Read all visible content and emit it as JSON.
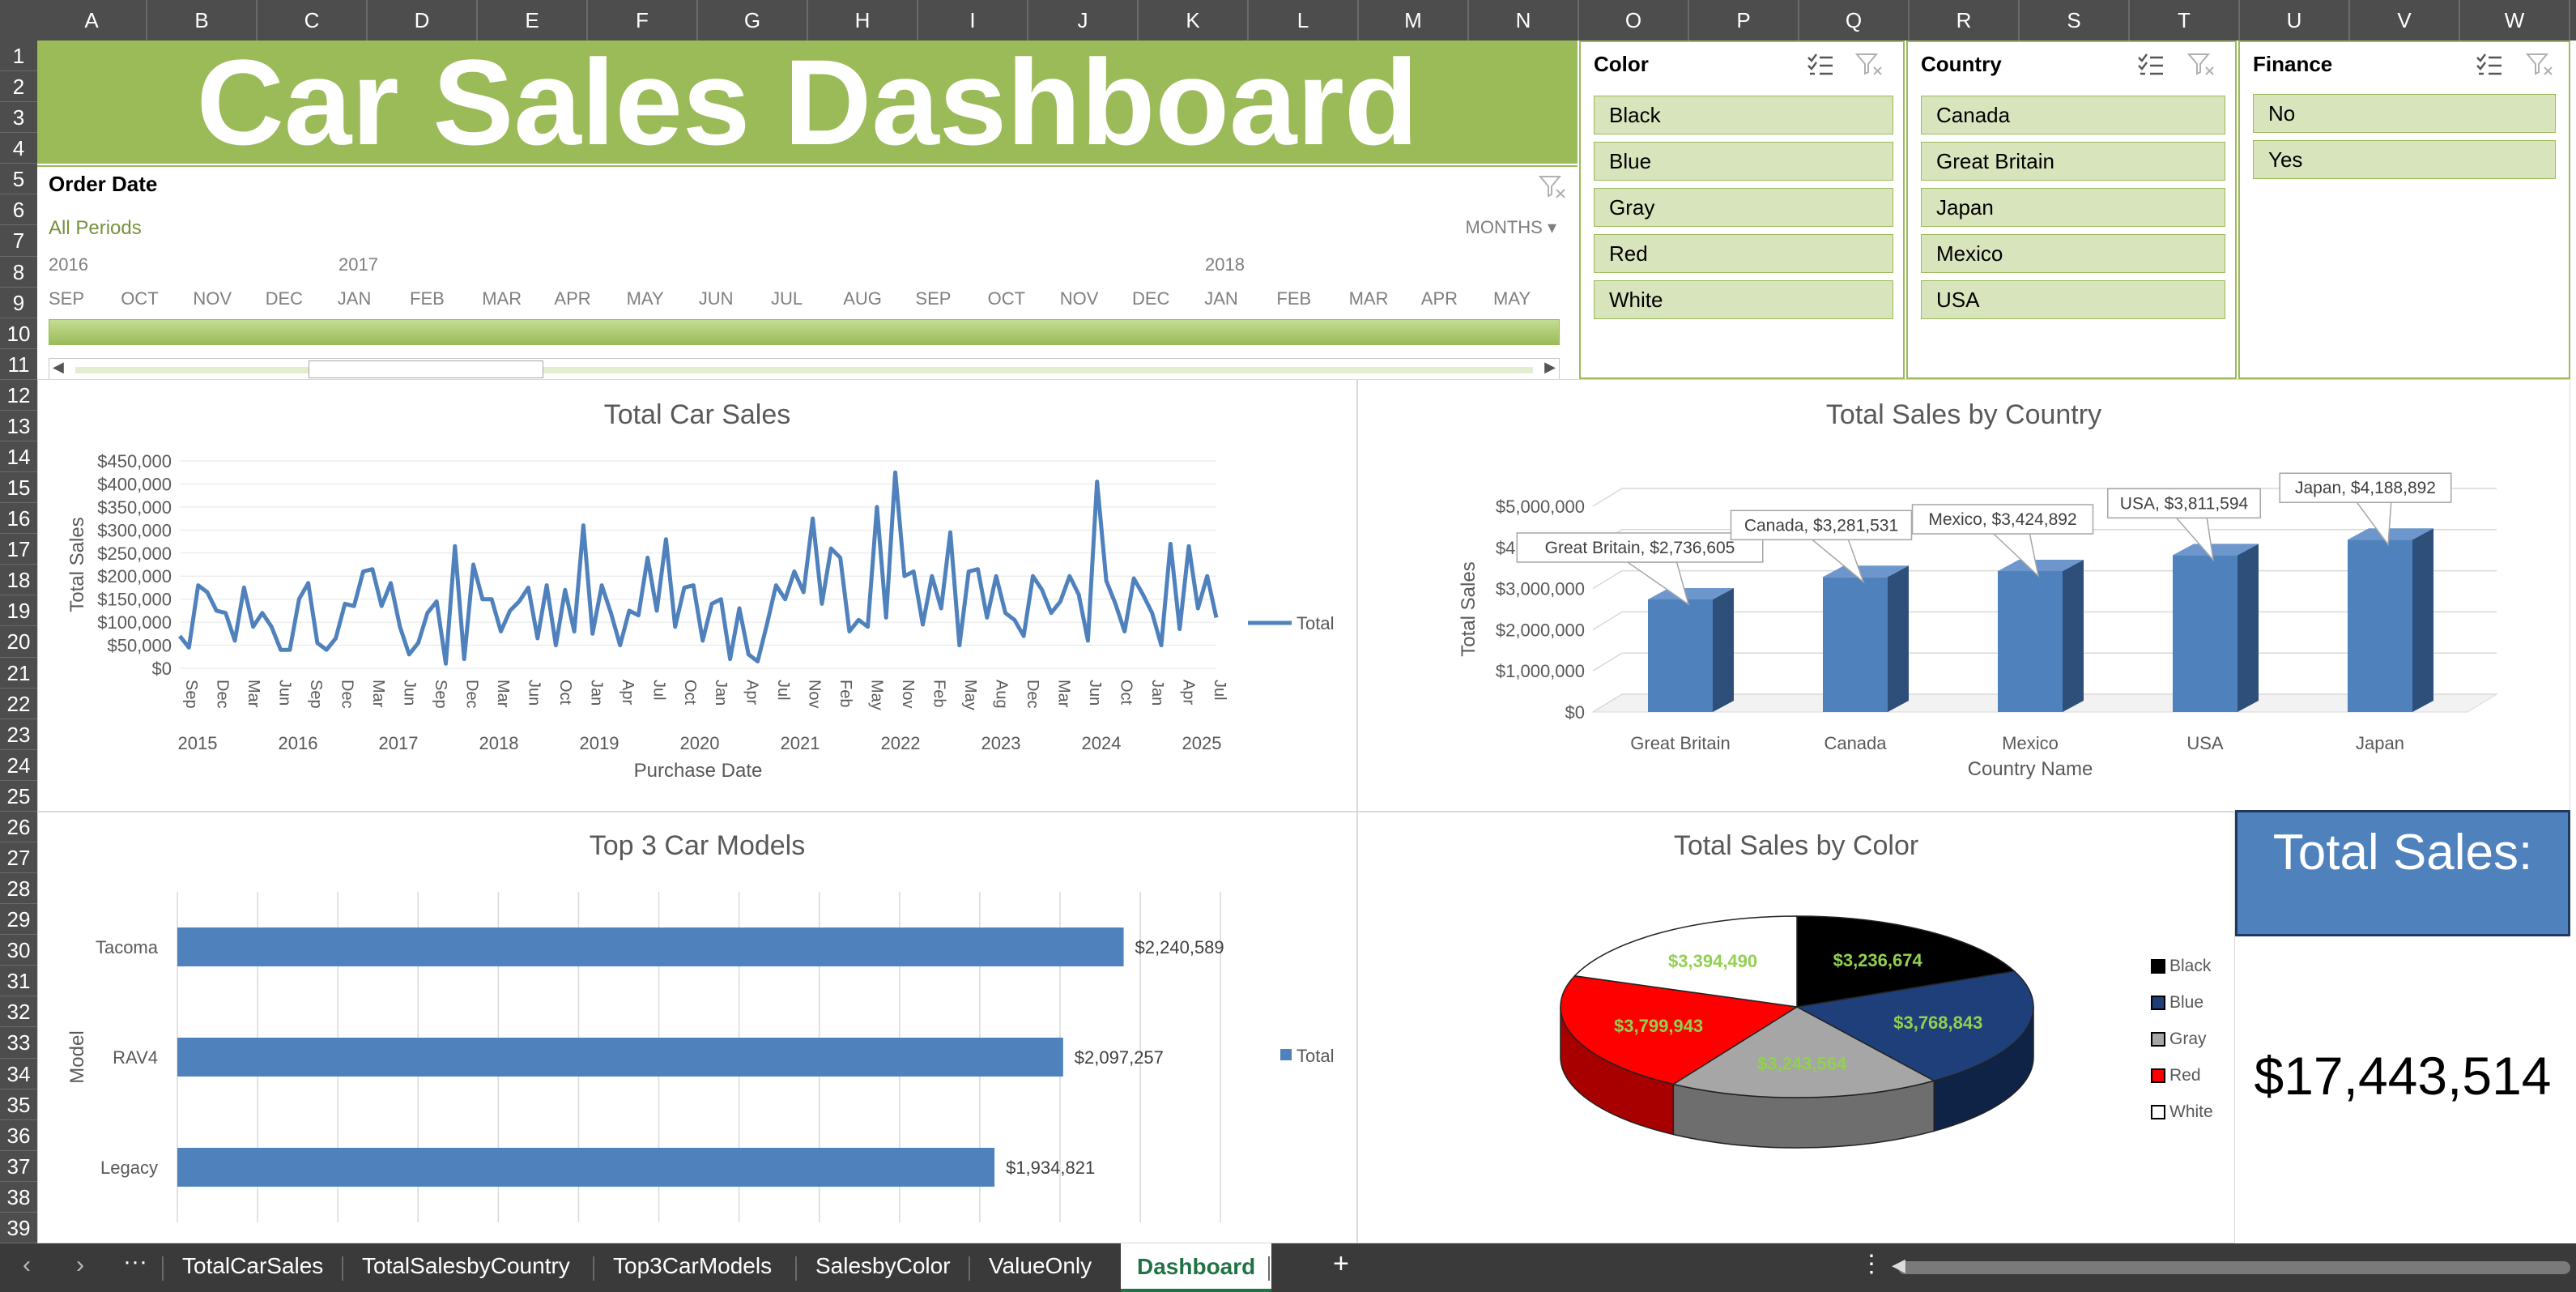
{
  "columns": [
    "A",
    "B",
    "C",
    "D",
    "E",
    "F",
    "G",
    "H",
    "I",
    "J",
    "K",
    "L",
    "M",
    "N",
    "O",
    "P",
    "Q",
    "R",
    "S",
    "T",
    "U",
    "V",
    "W"
  ],
  "rows": [
    "1",
    "2",
    "3",
    "4",
    "5",
    "6",
    "7",
    "8",
    "9",
    "10",
    "11",
    "12",
    "13",
    "14",
    "15",
    "16",
    "17",
    "18",
    "19",
    "20",
    "21",
    "22",
    "23",
    "24",
    "25",
    "26",
    "27",
    "28",
    "29",
    "30",
    "31",
    "32",
    "33",
    "34",
    "35",
    "36",
    "37",
    "38",
    "39"
  ],
  "banner": {
    "title": "Car Sales Dashboard"
  },
  "timeline": {
    "title": "Order Date",
    "period": "All Periods",
    "level": "MONTHS",
    "years": [
      "2016",
      "2017",
      "2018"
    ],
    "months": [
      "SEP",
      "OCT",
      "NOV",
      "DEC",
      "JAN",
      "FEB",
      "MAR",
      "APR",
      "MAY",
      "JUN",
      "JUL",
      "AUG",
      "SEP",
      "OCT",
      "NOV",
      "DEC",
      "JAN",
      "FEB",
      "MAR",
      "APR",
      "MAY"
    ]
  },
  "slicers": [
    {
      "title": "Color",
      "items": [
        "Black",
        "Blue",
        "Gray",
        "Red",
        "White"
      ]
    },
    {
      "title": "Country",
      "items": [
        "Canada",
        "Great Britain",
        "Japan",
        "Mexico",
        "USA"
      ]
    },
    {
      "title": "Finance",
      "items": [
        "No",
        "Yes"
      ]
    }
  ],
  "chart_data": [
    {
      "type": "line",
      "title": "Total Car Sales",
      "xlabel": "Purchase Date",
      "ylabel": "Total Sales",
      "ylim": [
        0,
        450000
      ],
      "yticks": [
        "$0",
        "$50,000",
        "$100,000",
        "$150,000",
        "$200,000",
        "$250,000",
        "$300,000",
        "$350,000",
        "$400,000",
        "$450,000"
      ],
      "month_ticks": [
        "Sep",
        "Dec",
        "Mar",
        "Jun",
        "Sep",
        "Dec",
        "Mar",
        "Jun",
        "Sep",
        "Dec",
        "Mar",
        "Jun",
        "Oct",
        "Jan",
        "Apr",
        "Jul",
        "Oct",
        "Jan",
        "Apr",
        "Jul",
        "Nov",
        "Feb",
        "May",
        "Nov",
        "Feb",
        "May",
        "Aug",
        "Dec",
        "Mar",
        "Jun",
        "Oct",
        "Jan",
        "Apr",
        "Jul"
      ],
      "year_ticks": [
        "2015",
        "2016",
        "2017",
        "2018",
        "2019",
        "2020",
        "2021",
        "2022",
        "2023",
        "2024",
        "2025"
      ],
      "legend": "Total",
      "series": [
        {
          "name": "Total",
          "values": [
            70000,
            45000,
            180000,
            165000,
            125000,
            120000,
            60000,
            175000,
            90000,
            120000,
            90000,
            40000,
            40000,
            150000,
            185000,
            55000,
            40000,
            65000,
            140000,
            135000,
            210000,
            215000,
            135000,
            185000,
            90000,
            30000,
            55000,
            120000,
            145000,
            10000,
            265000,
            20000,
            225000,
            150000,
            150000,
            80000,
            125000,
            145000,
            175000,
            65000,
            180000,
            50000,
            170000,
            80000,
            310000,
            75000,
            180000,
            120000,
            50000,
            125000,
            115000,
            240000,
            125000,
            280000,
            90000,
            175000,
            180000,
            60000,
            140000,
            150000,
            20000,
            130000,
            30000,
            15000,
            95000,
            180000,
            150000,
            210000,
            165000,
            325000,
            140000,
            260000,
            240000,
            80000,
            105000,
            90000,
            350000,
            110000,
            425000,
            200000,
            210000,
            95000,
            200000,
            130000,
            295000,
            50000,
            210000,
            215000,
            110000,
            200000,
            120000,
            105000,
            70000,
            200000,
            170000,
            120000,
            145000,
            200000,
            160000,
            60000,
            405000,
            190000,
            140000,
            80000,
            195000,
            160000,
            120000,
            50000,
            270000,
            85000,
            265000,
            130000,
            200000,
            110000
          ]
        }
      ]
    },
    {
      "type": "bar",
      "title": "Total Sales by Country",
      "xlabel": "Country Name",
      "ylabel": "Total Sales",
      "ylim": [
        0,
        5000000
      ],
      "yticks": [
        "$0",
        "$1,000,000",
        "$2,000,000",
        "$3,000,000",
        "$4,000,000",
        "$5,000,000"
      ],
      "categories": [
        "Great Britain",
        "Canada",
        "Mexico",
        "USA",
        "Japan"
      ],
      "values": [
        2736605,
        3281531,
        3424892,
        3811594,
        4188892
      ],
      "labels": [
        "Great Britain, $2,736,605",
        "Canada, $3,281,531",
        "Mexico, $3,424,892",
        "USA, $3,811,594",
        "Japan, $4,188,892"
      ]
    },
    {
      "type": "bar",
      "title": "Top 3 Car Models",
      "ylabel": "Model",
      "orientation": "horizontal",
      "categories": [
        "Tacoma",
        "RAV4",
        "Legacy"
      ],
      "values": [
        2240589,
        2097257,
        1934821
      ],
      "labels": [
        "$2,240,589",
        "$2,097,257",
        "$1,934,821"
      ],
      "legend": "Total"
    },
    {
      "type": "pie",
      "title": "Total Sales by Color",
      "categories": [
        "Black",
        "Blue",
        "Gray",
        "Red",
        "White"
      ],
      "values": [
        3236674,
        3768843,
        3243564,
        3799943,
        3394490
      ],
      "labels": [
        "$3,236,674",
        "$3,768,843",
        "$3,243,564",
        "$3,799,943",
        "$3,394,490"
      ],
      "colors": [
        "#000000",
        "#1f3f7a",
        "#a6a6a6",
        "#ff0000",
        "#ffffff"
      ],
      "legend": [
        "Black",
        "Blue",
        "Gray",
        "Red",
        "White"
      ]
    }
  ],
  "total": {
    "label": "Total Sales:",
    "value": "$17,443,514"
  },
  "tabs": [
    "TotalCarSales",
    "TotalSalesbyCountry",
    "Top3CarModels",
    "SalesbyColor",
    "ValueOnly",
    "Dashboard"
  ],
  "colors": {
    "accent": "#9bbb59",
    "series": "#4f81bd",
    "label_green": "#92d050"
  }
}
